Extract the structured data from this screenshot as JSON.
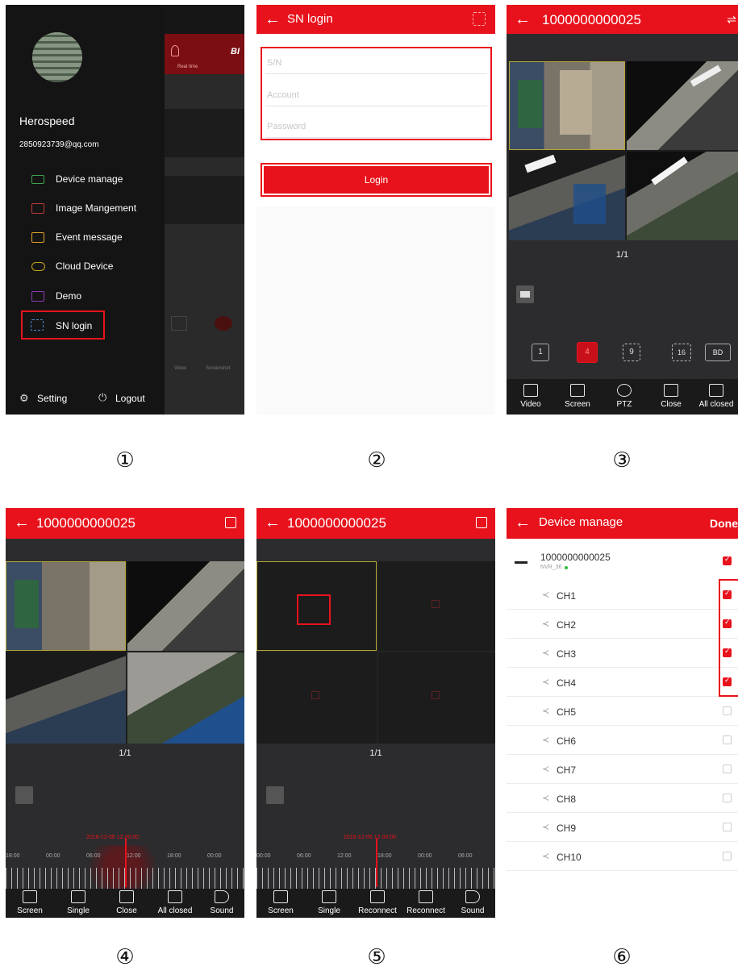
{
  "captions": [
    "①",
    "②",
    "③",
    "④",
    "⑤",
    "⑥"
  ],
  "panel1": {
    "username": "Herospeed",
    "email": "2850923739@qq.com",
    "menu": [
      {
        "label": "Device manage",
        "icon": "camera-icon"
      },
      {
        "label": "Image Mangement",
        "icon": "image-icon"
      },
      {
        "label": "Event message",
        "icon": "mail-icon"
      },
      {
        "label": "Cloud Device",
        "icon": "cloud-icon"
      },
      {
        "label": "Demo",
        "icon": "demo-icon"
      },
      {
        "label": "SN login",
        "icon": "scan-icon"
      }
    ],
    "setting": "Setting",
    "logout": "Logout",
    "bg_tab": "Real time",
    "bg_video": "Video",
    "bg_screenshot": "Screenshot",
    "bg_brand": "BI"
  },
  "panel2": {
    "title": "SN login",
    "fields": [
      {
        "placeholder": "S/N"
      },
      {
        "placeholder": "Account"
      },
      {
        "placeholder": "Password"
      }
    ],
    "login": "Login"
  },
  "panel3": {
    "title": "1000000000025",
    "page": "1/1",
    "layout_buttons": [
      "1",
      "4",
      "9",
      "16",
      "BD"
    ],
    "toolbar": [
      "Video",
      "Screen",
      "PTZ",
      "Close",
      "All closed"
    ]
  },
  "panel4": {
    "title": "1000000000025",
    "page": "1/1",
    "time_marker": "2018-12-06 12:00:00",
    "times": [
      "18:00",
      "00:00",
      "06:00",
      "12:00",
      "18:00",
      "00:00"
    ],
    "toolbar": [
      "Screen",
      "Single",
      "Close",
      "All closed",
      "Sound"
    ]
  },
  "panel5": {
    "title": "1000000000025",
    "page": "1/1",
    "time_marker": "2018-12-06 12:00:00",
    "times": [
      "00:00",
      "06:00",
      "12:00",
      "18:00",
      "00:00",
      "06:00"
    ],
    "toolbar": [
      "Screen",
      "Single",
      "Reconnect",
      "Reconnect",
      "Sound"
    ]
  },
  "panel6": {
    "title": "Device manage",
    "done": "Done",
    "device": "1000000000025",
    "device_sub": "NVR_36",
    "channels": [
      {
        "label": "CH1",
        "checked": true
      },
      {
        "label": "CH2",
        "checked": true
      },
      {
        "label": "CH3",
        "checked": true
      },
      {
        "label": "CH4",
        "checked": true
      },
      {
        "label": "CH5",
        "checked": false
      },
      {
        "label": "CH6",
        "checked": false
      },
      {
        "label": "CH7",
        "checked": false
      },
      {
        "label": "CH8",
        "checked": false
      },
      {
        "label": "CH9",
        "checked": false
      },
      {
        "label": "CH10",
        "checked": false
      }
    ]
  },
  "colors": {
    "accent": "#e8121c",
    "dark_bg": "#2c2c2e",
    "drawer_bg": "#141414"
  }
}
